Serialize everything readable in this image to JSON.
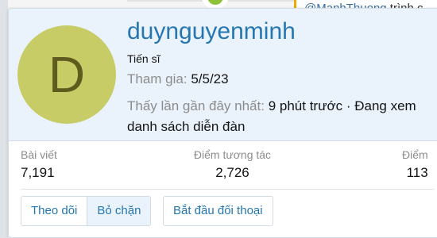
{
  "background": {
    "post_mention": "@ManhThuong",
    "post_text": "trình c"
  },
  "profile": {
    "avatar_letter": "D",
    "username": "duynguyenminh",
    "user_title": "Tiến sĩ",
    "joined_label": "Tham gia:",
    "joined_value": "5/5/23",
    "last_seen_label": "Thấy lần gần đây nhất:",
    "last_seen_value": "9 phút trước · Đang xem danh sách diễn đàn"
  },
  "stats": [
    {
      "label": "Bài viết",
      "value": "7,191"
    },
    {
      "label": "Điểm tương tác",
      "value": "2,726"
    },
    {
      "label": "Điểm",
      "value": "113"
    }
  ],
  "actions": {
    "follow_label": "Theo dõi",
    "unblock_label": "Bỏ chặn",
    "start_conversation_label": "Bắt đầu đối thoại"
  },
  "colors": {
    "accent": "#2577b1",
    "avatar_bg": "#c8cc66",
    "header_bg": "#eaf3fc"
  }
}
